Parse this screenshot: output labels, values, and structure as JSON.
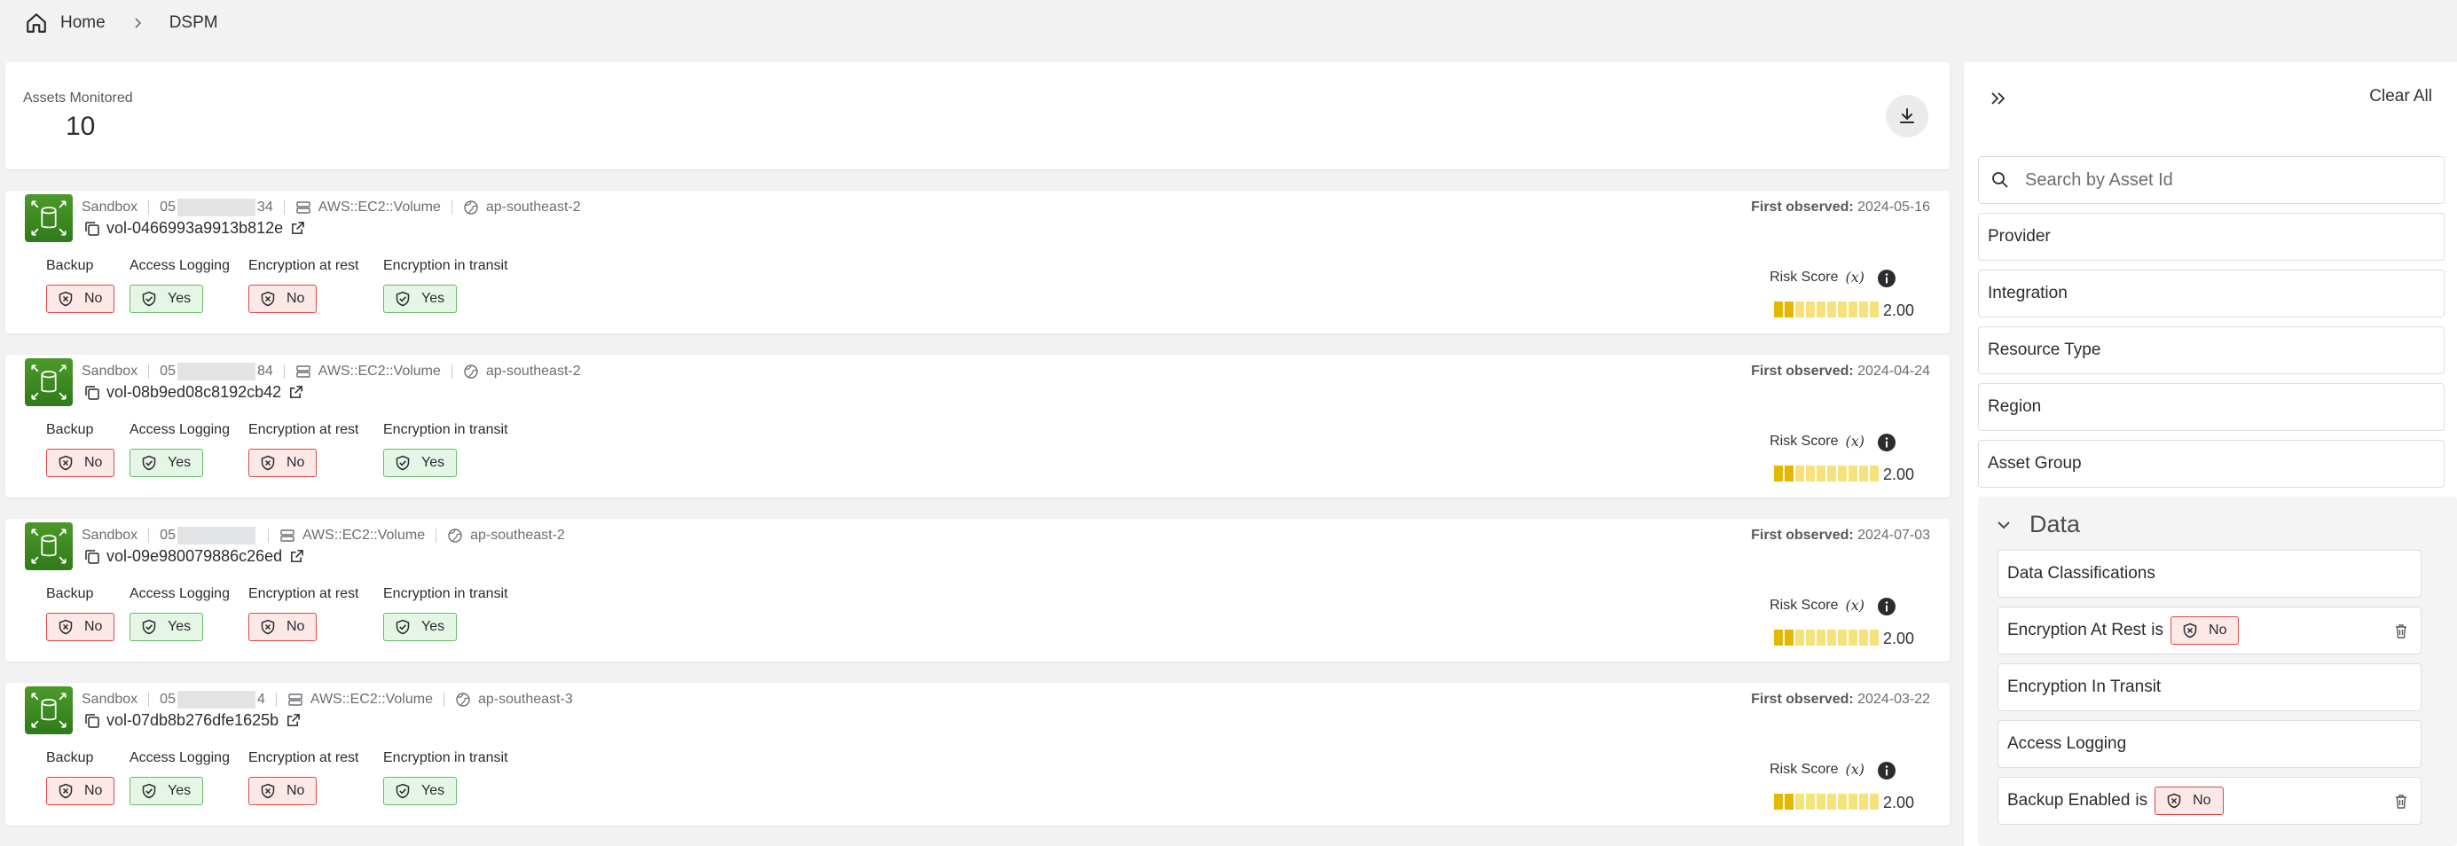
{
  "breadcrumb": {
    "home": "Home",
    "current": "DSPM"
  },
  "summary": {
    "label": "Assets Monitored",
    "value": "10"
  },
  "attribute_labels": {
    "backup": "Backup",
    "access_logging": "Access Logging",
    "encryption_at_rest": "Encryption at rest",
    "encryption_in_transit": "Encryption in transit"
  },
  "labels": {
    "first_observed": "First observed:",
    "risk_score": "Risk Score",
    "fx": "(x)"
  },
  "assets": [
    {
      "env": "Sandbox",
      "account_prefix": "05",
      "account_suffix": "34",
      "type": "AWS::EC2::Volume",
      "region": "ap-southeast-2",
      "id": "vol-0466993a9913b812e",
      "first_observed": "2024-05-16",
      "backup": "No",
      "access_logging": "Yes",
      "encryption_at_rest": "No",
      "encryption_in_transit": "Yes",
      "risk_score": "2.00",
      "risk_level": 0.2
    },
    {
      "env": "Sandbox",
      "account_prefix": "05",
      "account_suffix": "84",
      "type": "AWS::EC2::Volume",
      "region": "ap-southeast-2",
      "id": "vol-08b9ed08c8192cb42",
      "first_observed": "2024-04-24",
      "backup": "No",
      "access_logging": "Yes",
      "encryption_at_rest": "No",
      "encryption_in_transit": "Yes",
      "risk_score": "2.00",
      "risk_level": 0.2
    },
    {
      "env": "Sandbox",
      "account_prefix": "05",
      "account_suffix": "",
      "type": "AWS::EC2::Volume",
      "region": "ap-southeast-2",
      "id": "vol-09e980079886c26ed",
      "first_observed": "2024-07-03",
      "backup": "No",
      "access_logging": "Yes",
      "encryption_at_rest": "No",
      "encryption_in_transit": "Yes",
      "risk_score": "2.00",
      "risk_level": 0.2
    },
    {
      "env": "Sandbox",
      "account_prefix": "05",
      "account_suffix": "4",
      "type": "AWS::EC2::Volume",
      "region": "ap-southeast-3",
      "id": "vol-07db8b276dfe1625b",
      "first_observed": "2024-03-22",
      "backup": "No",
      "access_logging": "Yes",
      "encryption_at_rest": "No",
      "encryption_in_transit": "Yes",
      "risk_score": "2.00",
      "risk_level": 0.2
    }
  ],
  "filters": {
    "clear_all": "Clear All",
    "search_placeholder": "Search by Asset Id",
    "items": [
      "Provider",
      "Integration",
      "Resource Type",
      "Region",
      "Asset Group"
    ],
    "data_group": {
      "title": "Data",
      "items": [
        {
          "label": "Data Classifications"
        },
        {
          "label": "Encryption At Rest",
          "is": "is",
          "value": "No"
        },
        {
          "label": "Encryption In Transit"
        },
        {
          "label": "Access Logging"
        },
        {
          "label": "Backup Enabled",
          "is": "is",
          "value": "No"
        }
      ]
    }
  },
  "colors": {
    "no_bg": "#fde8e8",
    "no_border": "#d94a4a",
    "yes_bg": "#e6f6e6",
    "yes_border": "#66bb66",
    "risk_on": "#e5b800",
    "risk_off": "#f6e27a",
    "asset_icon": "#3a8a22"
  }
}
